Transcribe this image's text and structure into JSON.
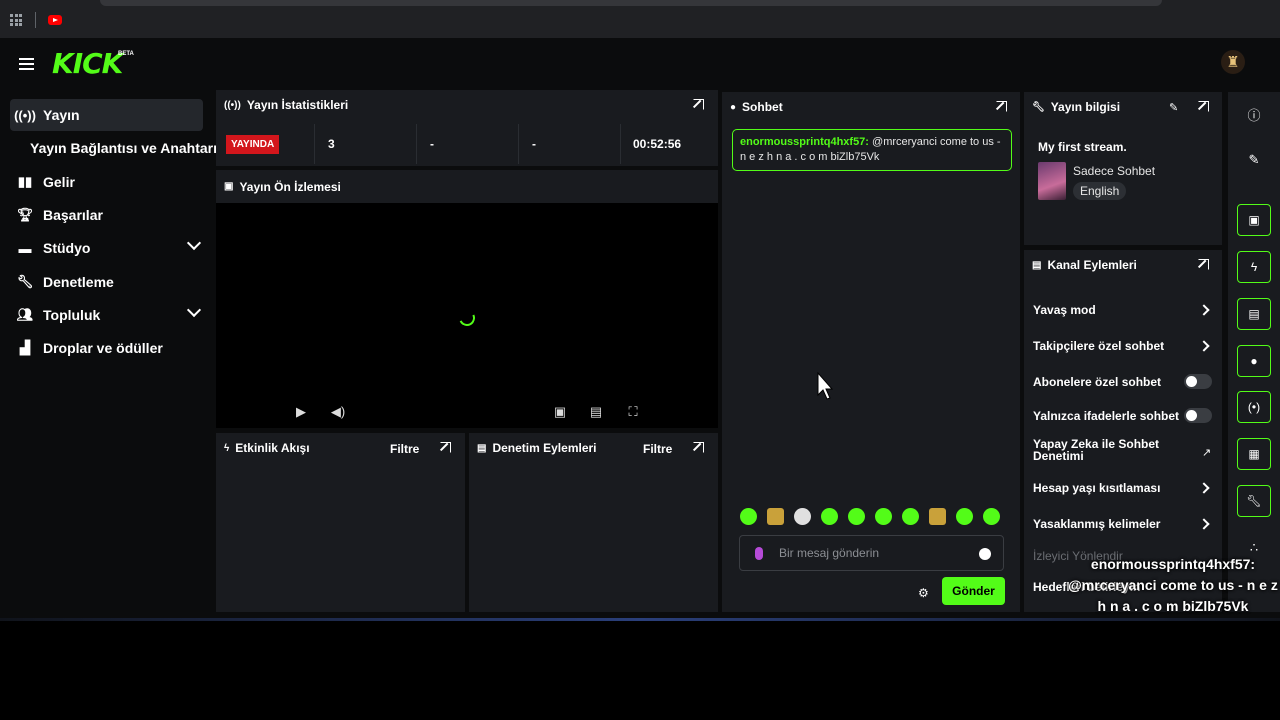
{
  "brand": {
    "logo": "KICK",
    "beta": "BETA",
    "accent": "#53fc18"
  },
  "sidebar": {
    "items": [
      {
        "label": "Yayın",
        "icon": "broadcast-icon"
      },
      {
        "label": "Yayın Bağlantısı ve Anahtarı"
      },
      {
        "label": "Gelir",
        "icon": "chart-icon"
      },
      {
        "label": "Başarılar",
        "icon": "trophy-icon"
      },
      {
        "label": "Stüdyo",
        "icon": "studio-icon"
      },
      {
        "label": "Denetleme",
        "icon": "wrench-icon"
      },
      {
        "label": "Topluluk",
        "icon": "people-icon"
      },
      {
        "label": "Droplar ve ödüller",
        "icon": "gift-icon"
      }
    ]
  },
  "stats": {
    "title": "Yayın İstatistikleri",
    "live_label": "YAYINDA",
    "viewers": "3",
    "followers": "-",
    "subs": "-",
    "uptime": "00:52:56"
  },
  "preview": {
    "title": "Yayın Ön İzlemesi"
  },
  "activity": {
    "title": "Etkinlik Akışı",
    "filter": "Filtre"
  },
  "moderation": {
    "title": "Denetim Eylemleri",
    "filter": "Filtre"
  },
  "chat": {
    "title": "Sohbet",
    "message": {
      "user": "enormoussprintq4hxf57:",
      "text": "@mrceryanci come to us - n e z h n a . c o m biZlb75Vk"
    },
    "placeholder": "Bir mesaj gönderin",
    "send_label": "Gönder"
  },
  "stream_info": {
    "title": "Yayın bilgisi",
    "stream_title": "My first stream.",
    "category": "Sadece Sohbet",
    "language": "English"
  },
  "channel_actions": {
    "title": "Kanal Eylemleri",
    "items": [
      "Yavaş mod",
      "Takipçilere özel sohbet",
      "Abonelere özel sohbet",
      "Yalnızca ifadelerle sohbet",
      "Yapay Zeka ile Sohbet Denetimi",
      "Hesap yaşı kısıtlaması",
      "Yasaklanmış kelimeler",
      "İzleyici Yönlendir",
      "Hedefleri belirleyin"
    ]
  },
  "overlay": {
    "user": "enormoussprintq4hxf57:",
    "text": "@mrceryanci come to us - n e z h n a . c o m biZlb75Vk"
  }
}
